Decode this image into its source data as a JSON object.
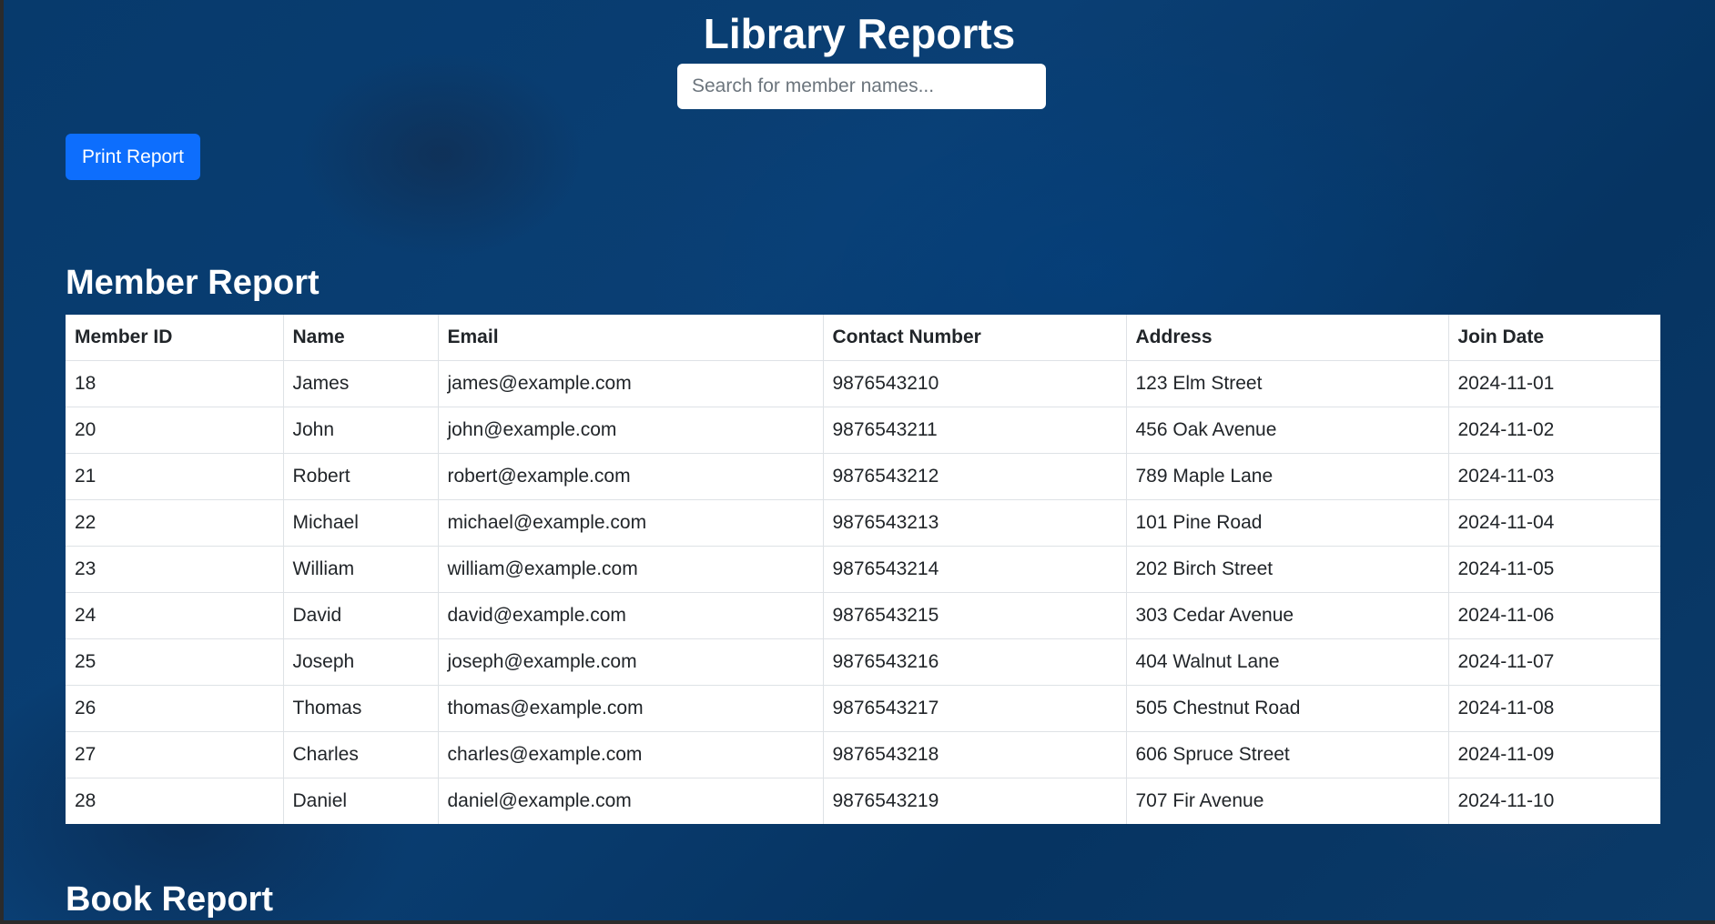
{
  "page": {
    "title": "Library Reports",
    "search_placeholder": "Search for member names...",
    "print_label": "Print Report"
  },
  "member_report": {
    "title": "Member Report",
    "columns": [
      "Member ID",
      "Name",
      "Email",
      "Contact Number",
      "Address",
      "Join Date"
    ],
    "rows": [
      [
        "18",
        "James",
        "james@example.com",
        "9876543210",
        "123 Elm Street",
        "2024-11-01"
      ],
      [
        "20",
        "John",
        "john@example.com",
        "9876543211",
        "456 Oak Avenue",
        "2024-11-02"
      ],
      [
        "21",
        "Robert",
        "robert@example.com",
        "9876543212",
        "789 Maple Lane",
        "2024-11-03"
      ],
      [
        "22",
        "Michael",
        "michael@example.com",
        "9876543213",
        "101 Pine Road",
        "2024-11-04"
      ],
      [
        "23",
        "William",
        "william@example.com",
        "9876543214",
        "202 Birch Street",
        "2024-11-05"
      ],
      [
        "24",
        "David",
        "david@example.com",
        "9876543215",
        "303 Cedar Avenue",
        "2024-11-06"
      ],
      [
        "25",
        "Joseph",
        "joseph@example.com",
        "9876543216",
        "404 Walnut Lane",
        "2024-11-07"
      ],
      [
        "26",
        "Thomas",
        "thomas@example.com",
        "9876543217",
        "505 Chestnut Road",
        "2024-11-08"
      ],
      [
        "27",
        "Charles",
        "charles@example.com",
        "9876543218",
        "606 Spruce Street",
        "2024-11-09"
      ],
      [
        "28",
        "Daniel",
        "daniel@example.com",
        "9876543219",
        "707 Fir Avenue",
        "2024-11-10"
      ]
    ]
  },
  "book_report": {
    "title": "Book Report"
  },
  "colors": {
    "accent": "#0d6efd",
    "background": "#0a3f74"
  }
}
